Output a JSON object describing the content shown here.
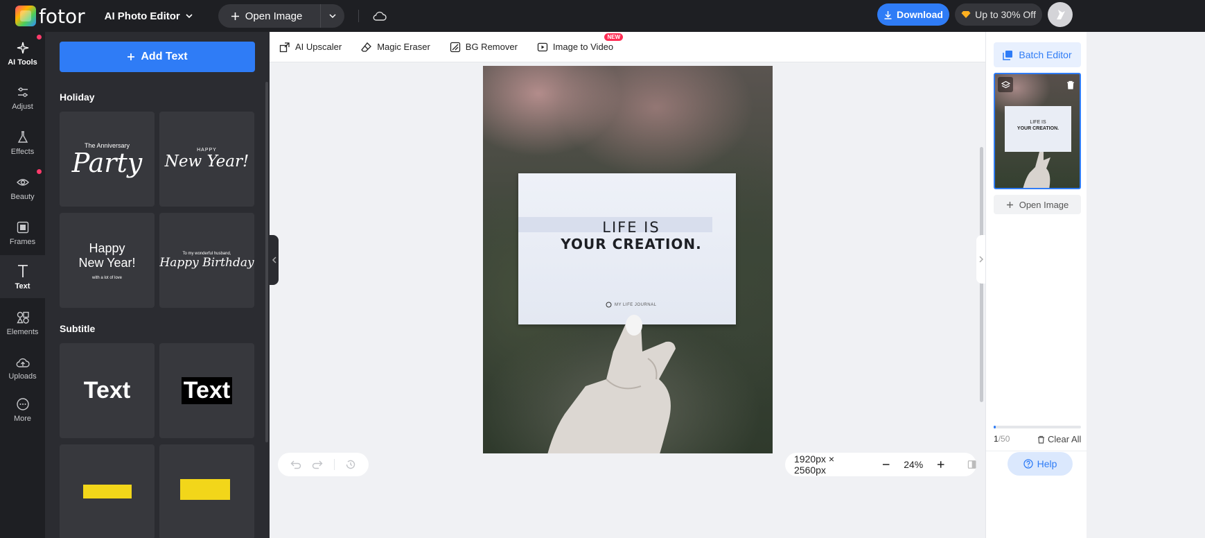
{
  "topbar": {
    "logo_text": "fotor",
    "app_title": "AI Photo Editor",
    "open_image_label": "Open Image",
    "download_label": "Download",
    "offer_label": "Up to 30% Off"
  },
  "rail": [
    {
      "label": "AI Tools",
      "icon": "sparkle-icon",
      "dot": true
    },
    {
      "label": "Adjust",
      "icon": "sliders-icon",
      "dot": false
    },
    {
      "label": "Effects",
      "icon": "flask-icon",
      "dot": false
    },
    {
      "label": "Beauty",
      "icon": "eye-icon",
      "dot": true
    },
    {
      "label": "Frames",
      "icon": "frame-icon",
      "dot": false
    },
    {
      "label": "Text",
      "icon": "text-icon",
      "dot": false
    },
    {
      "label": "Elements",
      "icon": "shapes-icon",
      "dot": false
    },
    {
      "label": "Uploads",
      "icon": "upload-cloud-icon",
      "dot": false
    },
    {
      "label": "More",
      "icon": "more-icon",
      "dot": false
    }
  ],
  "panel": {
    "add_text_label": "Add Text",
    "section_holiday": "Holiday",
    "section_subtitle": "Subtitle",
    "tiles": {
      "t1_line1": "The Anniversary",
      "t1_line2": "Party",
      "t2_line1": "HAPPY",
      "t2_line2": "New Year!",
      "t3_line1": "Happy",
      "t3_line2": "New Year!",
      "t3_line3": "with a lot of love",
      "t4_line1": "To my wonderful husband,",
      "t4_line2": "Happy Birthday",
      "t5_text": "Text",
      "t6_text": "Text"
    }
  },
  "toolbar": {
    "ai_upscaler": "AI Upscaler",
    "magic_eraser": "Magic Eraser",
    "bg_remover": "BG Remover",
    "image_to_video": "Image to Video",
    "new_badge": "NEW"
  },
  "canvas": {
    "card_line1": "LIFE IS",
    "card_line2": "YOUR CREATION.",
    "card_brand": "MY LIFE JOURNAL"
  },
  "bottom": {
    "dimensions": "1920px × 2560px",
    "zoom": "24%"
  },
  "right_panel": {
    "batch_editor": "Batch Editor",
    "thumb_line1": "LIFE IS",
    "thumb_line2": "YOUR CREATION.",
    "open_image": "Open Image",
    "count_current": "1",
    "count_total": "/50",
    "clear_all": "Clear All",
    "help": "Help",
    "progress_fraction": 0.02
  },
  "colors": {
    "accent": "#2f7cf6",
    "topbar_bg": "#1e1f23",
    "panel_bg": "#2b2c31",
    "badge_red": "#ff2d55"
  }
}
